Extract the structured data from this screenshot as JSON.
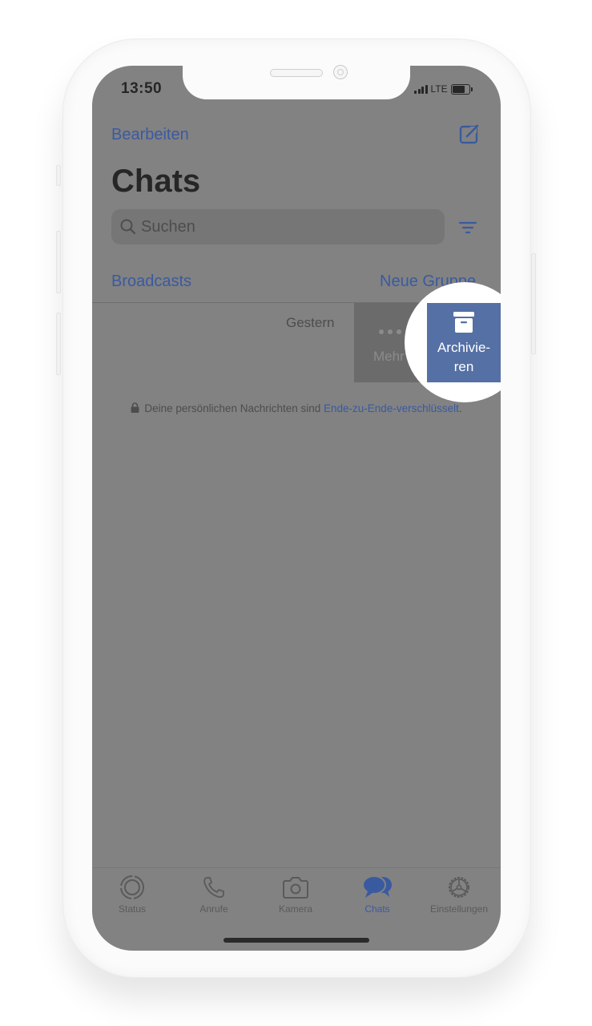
{
  "status_bar": {
    "time": "13:50",
    "network": "LTE"
  },
  "header": {
    "edit_label": "Bearbeiten",
    "compose_icon": "compose-icon",
    "title": "Chats"
  },
  "search": {
    "placeholder": "Suchen",
    "filter_icon": "filter-icon"
  },
  "links": {
    "broadcasts": "Broadcasts",
    "new_group": "Neue Gruppe"
  },
  "chat_row": {
    "timestamp": "Gestern",
    "swipe_actions": [
      {
        "label": "Mehr",
        "icon": "more-dots-icon"
      },
      {
        "label": "Archivie-\nren",
        "label_line1": "Archivie-",
        "label_line2": "ren",
        "icon": "archive-box-icon",
        "color": "#5570a5"
      }
    ]
  },
  "encryption_notice": {
    "text": "Deine persönlichen Nachrichten sind ",
    "link": "Ende-zu-Ende-verschlüsselt",
    "suffix": "."
  },
  "tab_bar": {
    "tabs": [
      {
        "label": "Status",
        "icon": "status-icon",
        "active": false
      },
      {
        "label": "Anrufe",
        "icon": "phone-icon",
        "active": false
      },
      {
        "label": "Kamera",
        "icon": "camera-icon",
        "active": false
      },
      {
        "label": "Chats",
        "icon": "chats-icon",
        "active": true
      },
      {
        "label": "Einstellungen",
        "icon": "settings-icon",
        "active": false
      }
    ]
  },
  "colors": {
    "accent": "#3a5aa0",
    "archive": "#5570a5",
    "overlay": "#828282"
  }
}
